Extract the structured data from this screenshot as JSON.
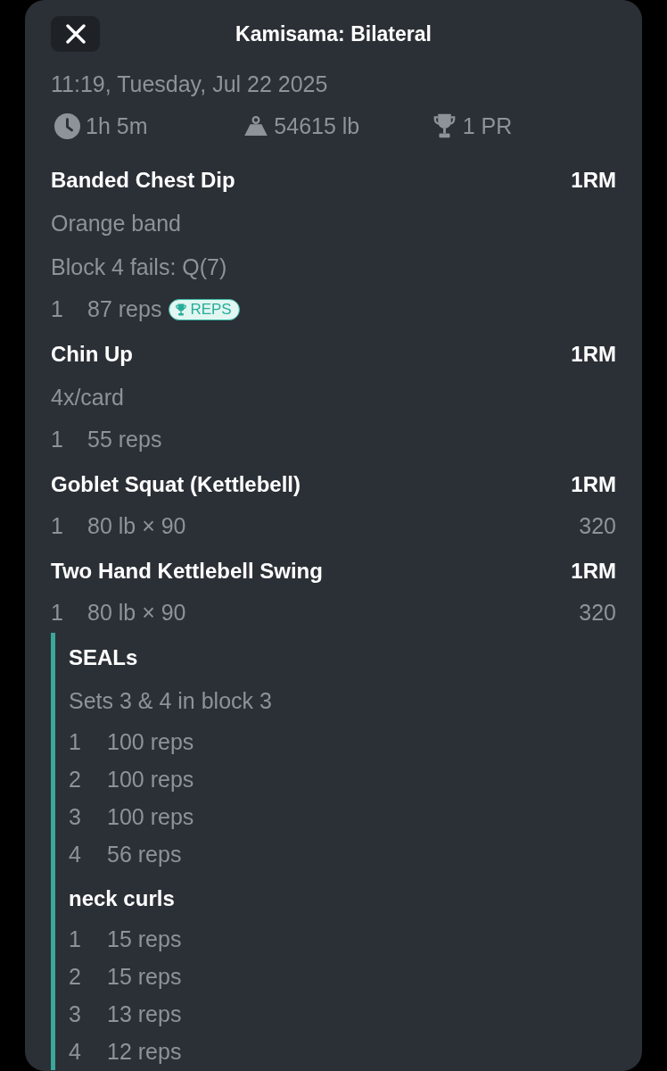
{
  "header": {
    "title": "Kamisama: Bilateral"
  },
  "date": "11:19, Tuesday, Jul 22 2025",
  "stats": [
    {
      "kind": "duration",
      "value": "1h 5m"
    },
    {
      "kind": "volume",
      "value": "54615 lb"
    },
    {
      "kind": "records",
      "value": "1 PR"
    }
  ],
  "exercises": [
    {
      "name": "Banded Chest Dip",
      "column_label": "1RM",
      "notes": [
        "Orange band",
        "Block 4 fails: Q(7)"
      ],
      "sets": [
        {
          "number": "1",
          "value": "87 reps",
          "badge": "REPS"
        }
      ]
    },
    {
      "name": "Chin Up",
      "column_label": "1RM",
      "notes": [
        "4x/card"
      ],
      "sets": [
        {
          "number": "1",
          "value": "55 reps"
        }
      ]
    },
    {
      "name": "Goblet Squat (Kettlebell)",
      "column_label": "1RM",
      "sets": [
        {
          "number": "1",
          "value": "80 lb × 90",
          "one_rm": "320"
        }
      ]
    },
    {
      "name": "Two Hand Kettlebell Swing",
      "column_label": "1RM",
      "sets": [
        {
          "number": "1",
          "value": "80 lb × 90",
          "one_rm": "320"
        }
      ]
    }
  ],
  "superset": {
    "exercises": [
      {
        "name": "SEALs",
        "notes": [
          "Sets 3 & 4 in block 3"
        ],
        "sets": [
          {
            "number": "1",
            "value": "100 reps"
          },
          {
            "number": "2",
            "value": "100 reps"
          },
          {
            "number": "3",
            "value": "100 reps"
          },
          {
            "number": "4",
            "value": "56 reps"
          }
        ]
      },
      {
        "name": "neck curls",
        "sets": [
          {
            "number": "1",
            "value": "15 reps"
          },
          {
            "number": "2",
            "value": "15 reps"
          },
          {
            "number": "3",
            "value": "13 reps"
          },
          {
            "number": "4",
            "value": "12 reps"
          }
        ]
      }
    ]
  }
}
